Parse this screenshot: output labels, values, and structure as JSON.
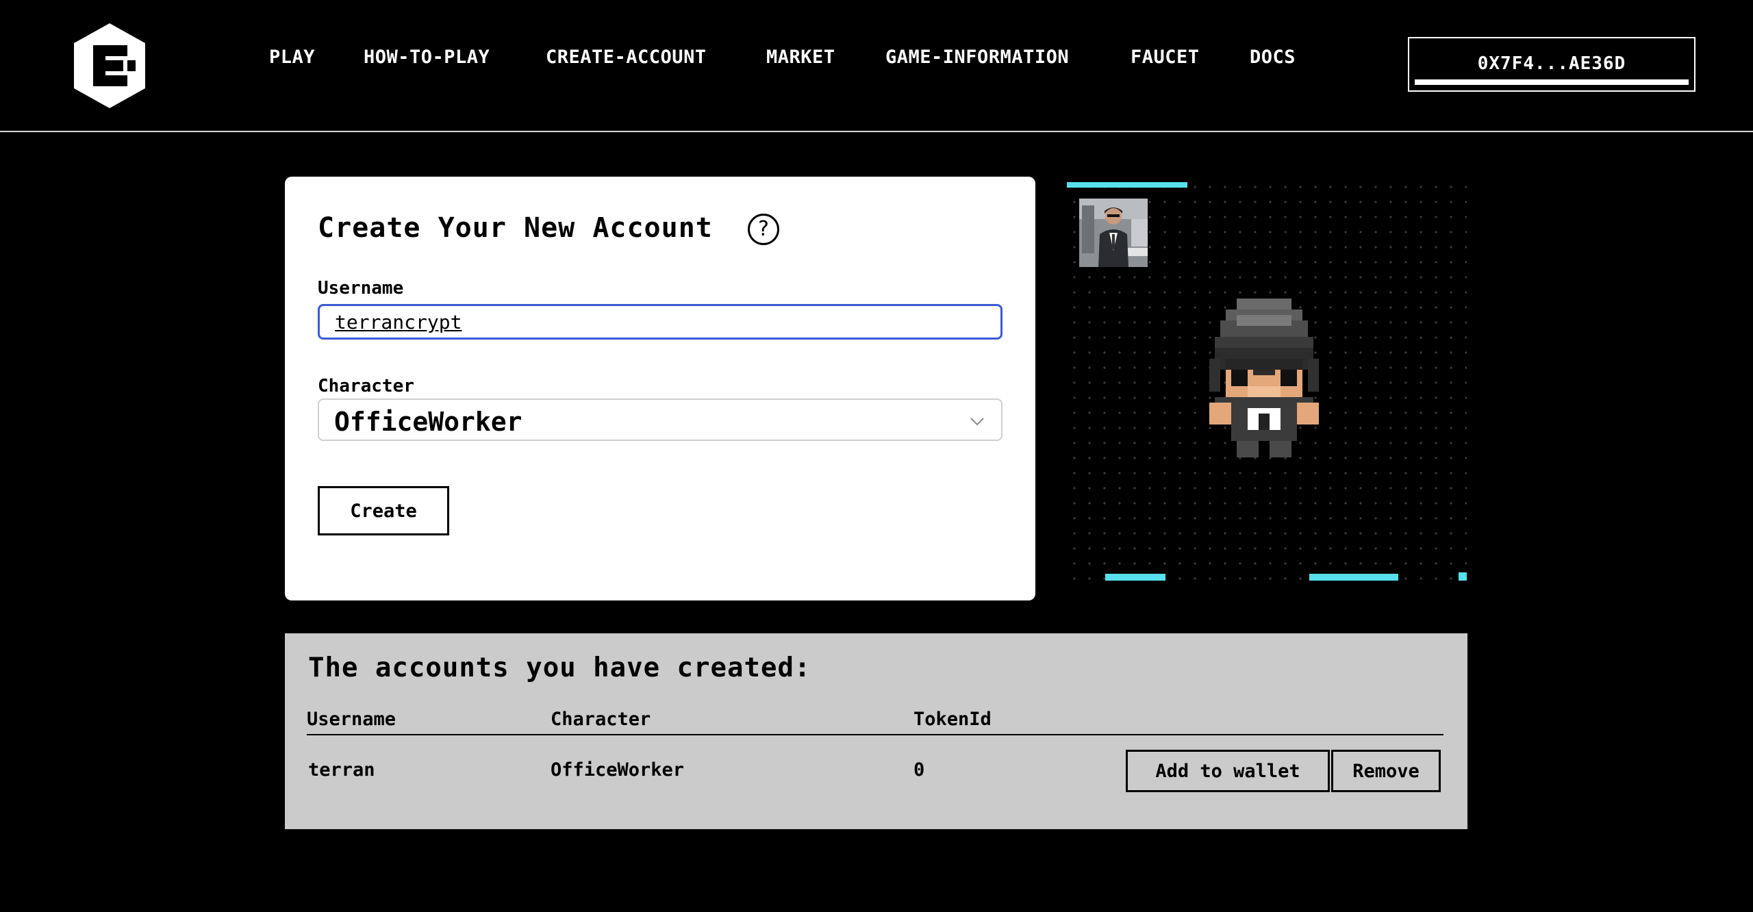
{
  "nav": {
    "items": [
      {
        "label": "PLAY"
      },
      {
        "label": "HOW-TO-PLAY"
      },
      {
        "label": "CREATE-ACCOUNT"
      },
      {
        "label": "MARKET"
      },
      {
        "label": "GAME-INFORMATION"
      },
      {
        "label": "FAUCET"
      },
      {
        "label": "DOCS"
      }
    ],
    "wallet_address": "0X7F4...AE36D"
  },
  "create_form": {
    "title": "Create Your New Account",
    "help_icon": "question-circle-icon",
    "username_label": "Username",
    "username_value": "terrancrypt",
    "character_label": "Character",
    "character_value": "OfficeWorker",
    "create_label": "Create"
  },
  "preview": {
    "accent_color": "#57e0ec"
  },
  "accounts": {
    "title": "The accounts you have created:",
    "columns": [
      "Username",
      "Character",
      "TokenId"
    ],
    "rows": [
      {
        "username": "terran",
        "character": "OfficeWorker",
        "token_id": "0",
        "add_label": "Add to wallet",
        "remove_label": "Remove"
      }
    ]
  },
  "colors": {
    "background": "#000000",
    "card": "#ffffff",
    "table_bg": "#cbcbcb",
    "input_border": "#3b5bd6"
  }
}
